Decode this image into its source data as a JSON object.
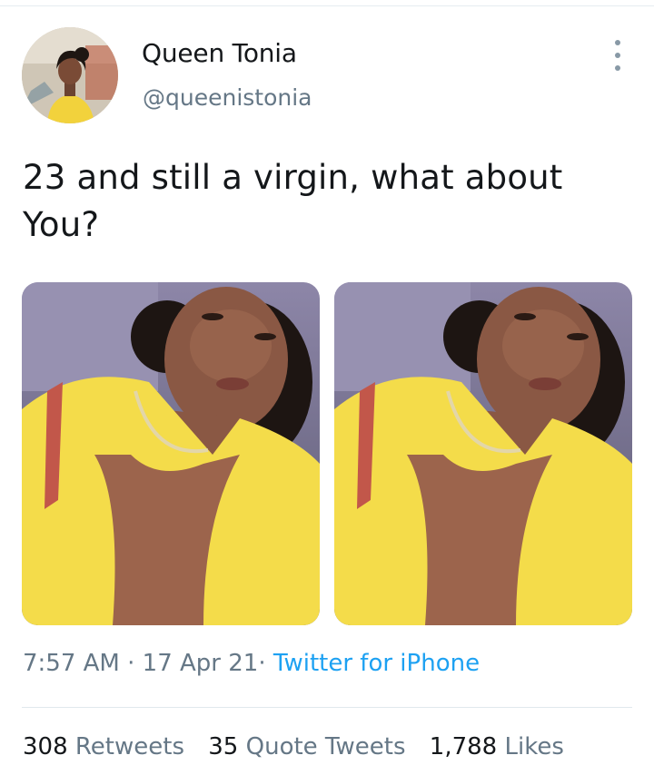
{
  "user": {
    "display_name": "Queen Tonia",
    "handle": "@queenistonia"
  },
  "tweet": {
    "text": "23 and still a virgin, what about You?",
    "time": "7:57 AM",
    "date": "17 Apr 21",
    "source": "Twitter for iPhone",
    "separator": "·"
  },
  "stats": {
    "retweets_count": "308",
    "retweets_label": "Retweets",
    "quotes_count": "35",
    "quotes_label": "Quote Tweets",
    "likes_count": "1,788",
    "likes_label": "Likes"
  },
  "colors": {
    "link": "#1da1f2",
    "secondary_text": "#657786",
    "primary_text": "#14171a"
  }
}
